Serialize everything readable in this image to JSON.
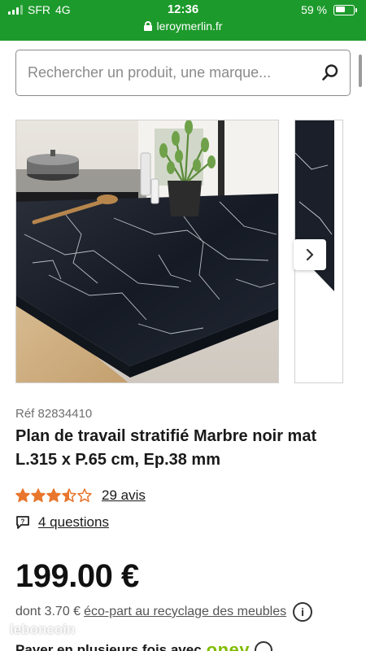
{
  "status_bar": {
    "carrier": "SFR",
    "network": "4G",
    "time": "12:36",
    "battery_percent": "59 %",
    "battery_level": 0.59,
    "url": "leroymerlin.fr"
  },
  "search": {
    "placeholder": "Rechercher un produit, une marque..."
  },
  "gallery": {
    "next_icon": "chevron-right-icon"
  },
  "product": {
    "ref": "Réf 82834410",
    "title": "Plan de travail stratifié Marbre noir mat L.315 x P.65 cm, Ep.38 mm",
    "rating": 3.5,
    "rating_max": 5,
    "reviews": "29 avis",
    "questions": "4 questions",
    "price": "199.00 €",
    "ecopart_prefix": "dont 3.70 €",
    "ecopart_link": "éco-part au recyclage des meubles",
    "pay_text": "Payer en plusieurs fois avec",
    "pay_brand": "oney"
  },
  "watermark": "leboncoin",
  "colors": {
    "brand_green": "#1d9a2c",
    "star_orange": "#e8762d",
    "oney_green": "#81bc00"
  }
}
